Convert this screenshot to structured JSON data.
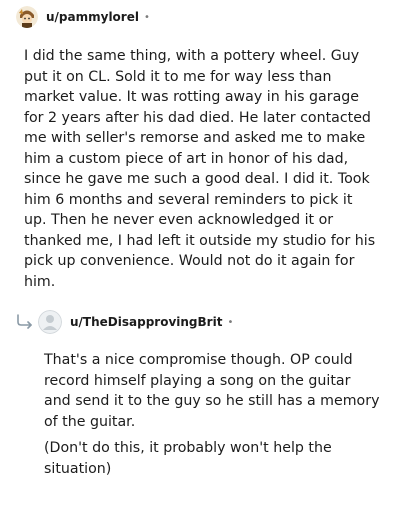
{
  "comment1": {
    "username": "u/pammylorel",
    "separator": "•",
    "body": "I did the same thing, with a pottery wheel. Guy put it on CL. Sold it to me for way less than market value. It was rotting away in his garage for 2 years after his dad died. He later contacted me with seller's remorse and asked me to make him a custom piece of art in honor of his dad, since he gave me such a good deal. I did it. Took him 6 months and several reminders to pick it up. Then he never even acknowledged it or thanked me, I had left it outside my studio for his pick up convenience. Would not do it again for him."
  },
  "comment2": {
    "username": "u/TheDisapprovingBrit",
    "separator": "•",
    "paragraphs": [
      "That's a nice compromise though. OP could record himself playing a song on the guitar and send it to the guy so he still has a memory of the guitar.",
      "(Don't do this, it probably won't help the situation)"
    ]
  }
}
